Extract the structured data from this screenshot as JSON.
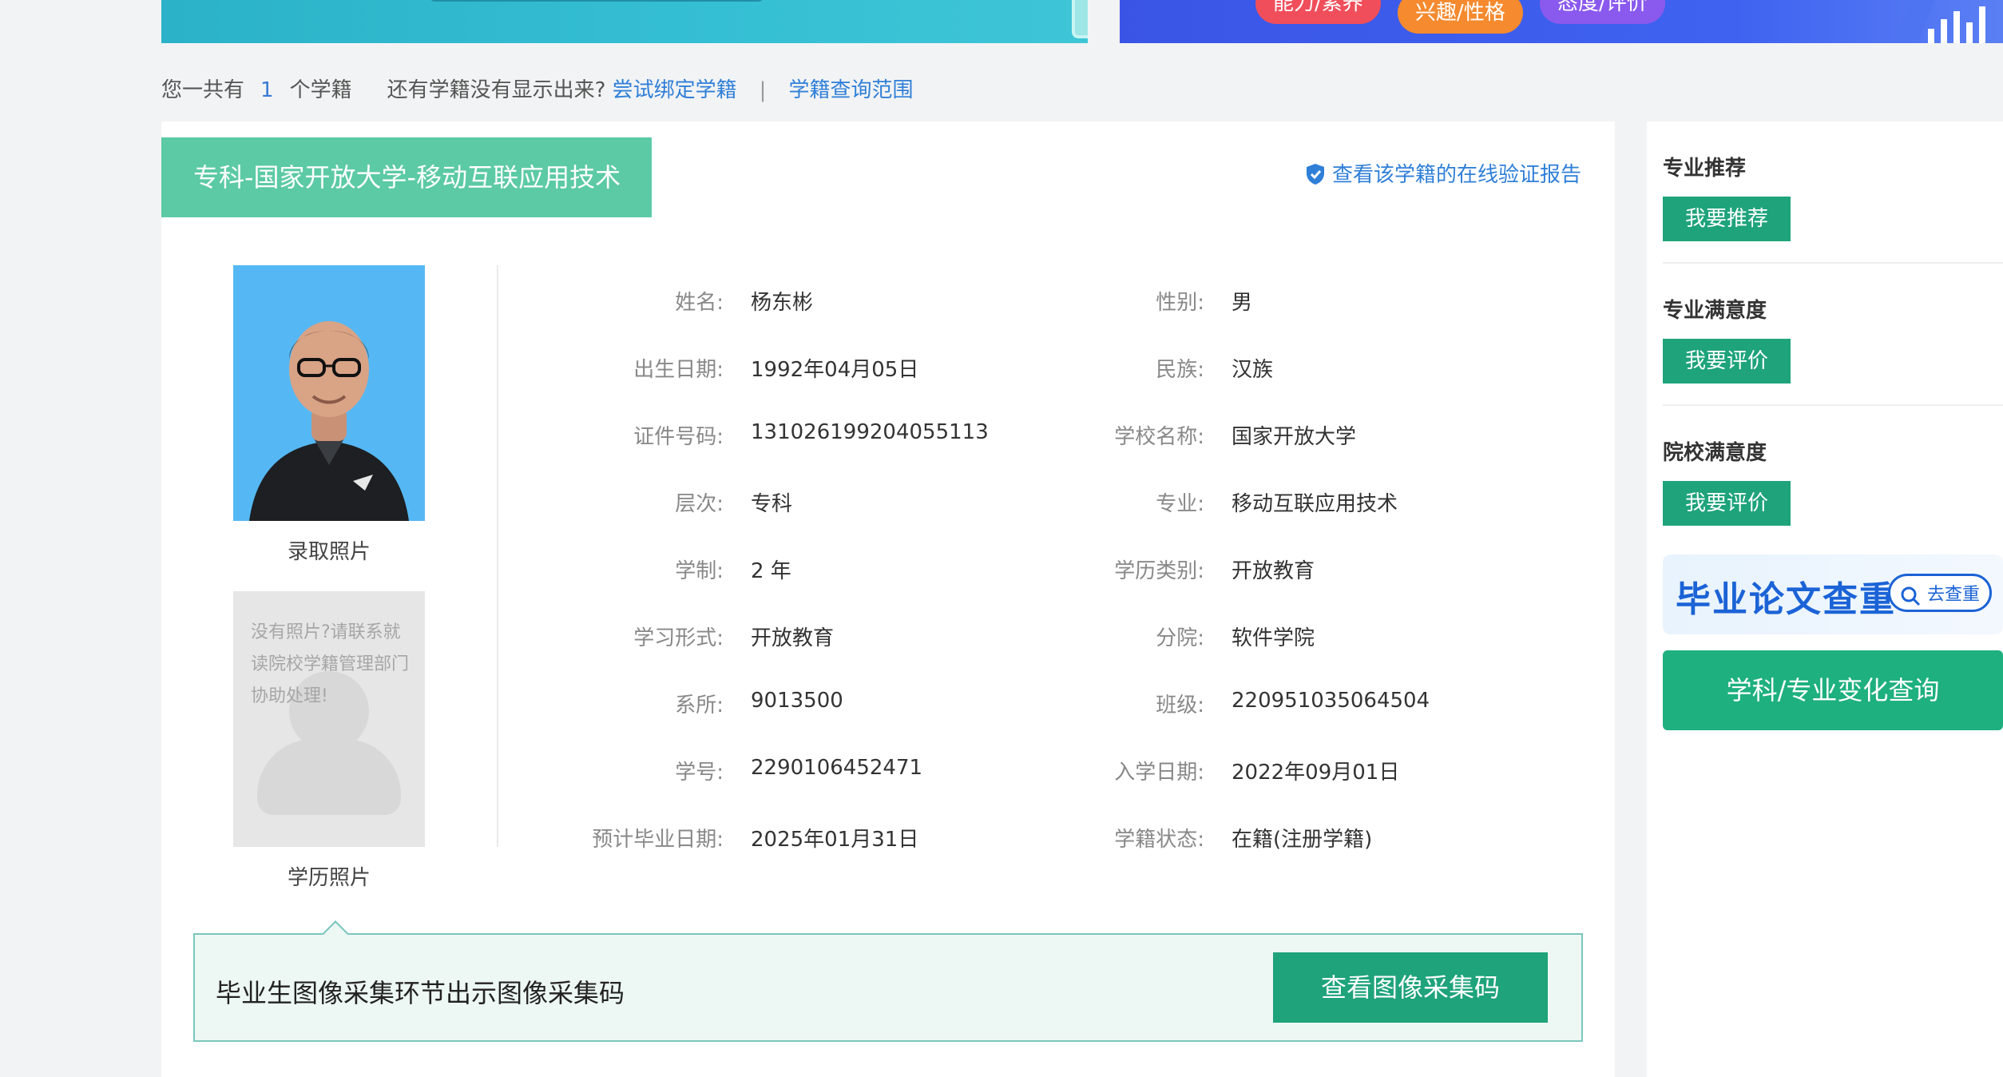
{
  "banner": {
    "pill_ability": "能力/素养",
    "pill_interest": "兴趣/性格",
    "pill_attitude": "态度/评价"
  },
  "summary": {
    "prefix": "您一共有",
    "count": "1",
    "suffix": "个学籍",
    "question": "还有学籍没有显示出来?",
    "bind_link": "尝试绑定学籍",
    "separator": "|",
    "scope_link": "学籍查询范围"
  },
  "record": {
    "title": "专科-国家开放大学-移动互联应用技术",
    "verify_link": "查看该学籍的在线验证报告",
    "photo_admission_caption": "录取照片",
    "photo_degree_caption": "学历照片",
    "photo_degree_placeholder": "没有照片?请联系就读院校学籍管理部门协助处理!"
  },
  "fields": {
    "name_label": "姓名:",
    "name": "杨东彬",
    "gender_label": "性别:",
    "gender": "男",
    "birth_label": "出生日期:",
    "birth": "1992年04月05日",
    "ethnicity_label": "民族:",
    "ethnicity": "汉族",
    "id_label": "证件号码:",
    "id_number": "131026199204055113",
    "school_label": "学校名称:",
    "school": "国家开放大学",
    "level_label": "层次:",
    "level": "专科",
    "major_label": "专业:",
    "major": "移动互联应用技术",
    "duration_label": "学制:",
    "duration": "2 年",
    "edu_type_label": "学历类别:",
    "edu_type": "开放教育",
    "study_form_label": "学习形式:",
    "study_form": "开放教育",
    "branch_label": "分院:",
    "branch": "软件学院",
    "dept_label": "系所:",
    "dept": "9013500",
    "class_label": "班级:",
    "class_no": "220951035064504",
    "student_no_label": "学号:",
    "student_no": "2290106452471",
    "enroll_label": "入学日期:",
    "enroll_date": "2022年09月01日",
    "grad_label": "预计毕业日期:",
    "grad_date": "2025年01月31日",
    "status_label": "学籍状态:",
    "status": "在籍(注册学籍)"
  },
  "notice": {
    "text": "毕业生图像采集环节出示图像采集码",
    "button": "查看图像采集码"
  },
  "sidebar": {
    "major_recommend_title": "专业推荐",
    "major_recommend_btn": "我要推荐",
    "major_satisfaction_title": "专业满意度",
    "major_satisfaction_btn": "我要评价",
    "school_satisfaction_title": "院校满意度",
    "school_satisfaction_btn": "我要评价",
    "thesis_title": "毕业论文查重",
    "thesis_btn": "去查重",
    "subject_change_btn": "学科/专业变化查询"
  },
  "colors": {
    "green_tag": "#5ccaa4",
    "green_button": "#1ea37a",
    "link_blue": "#2f7fd8"
  }
}
